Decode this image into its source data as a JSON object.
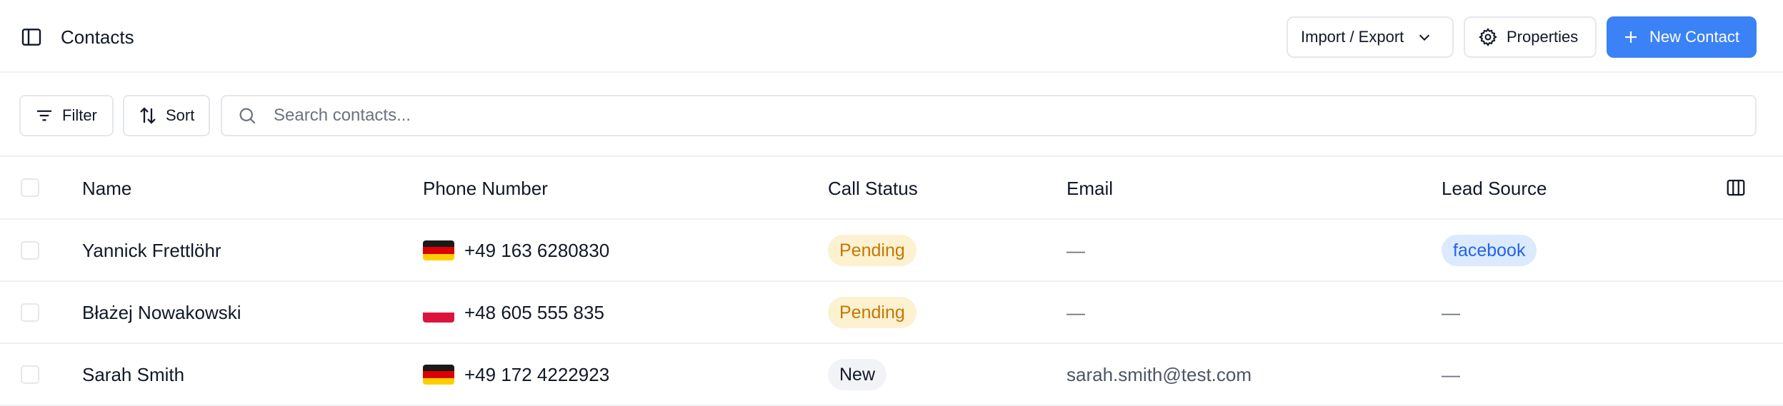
{
  "header": {
    "title": "Contacts",
    "import_export_label": "Import / Export",
    "properties_label": "Properties",
    "new_contact_label": "New Contact"
  },
  "toolbar": {
    "filter_label": "Filter",
    "sort_label": "Sort",
    "search_placeholder": "Search contacts...",
    "search_value": ""
  },
  "table": {
    "columns": [
      "Name",
      "Phone Number",
      "Call Status",
      "Email",
      "Lead Source"
    ],
    "rows": [
      {
        "name": "Yannick Frettlöhr",
        "phone": "+49 163 6280830",
        "flag": "de",
        "status": "Pending",
        "email": "—",
        "source": "facebook"
      },
      {
        "name": "Błażej Nowakowski",
        "phone": "+48 605 555 835",
        "flag": "pl",
        "status": "Pending",
        "email": "—",
        "source": "—"
      },
      {
        "name": "Sarah Smith",
        "phone": "+49 172 4222923",
        "flag": "de",
        "status": "New",
        "email": "sarah.smith@test.com",
        "source": "—"
      }
    ]
  },
  "colors": {
    "accent": "#3b82f6",
    "pending_bg": "#fcf1d0",
    "pending_text": "#c27803",
    "source_bg": "#dbeafe",
    "source_text": "#2563eb"
  },
  "icons": [
    "sidebar-toggle-icon",
    "chevron-down-icon",
    "gear-icon",
    "plus-icon",
    "filter-icon",
    "sort-icon",
    "search-icon",
    "columns-icon"
  ]
}
